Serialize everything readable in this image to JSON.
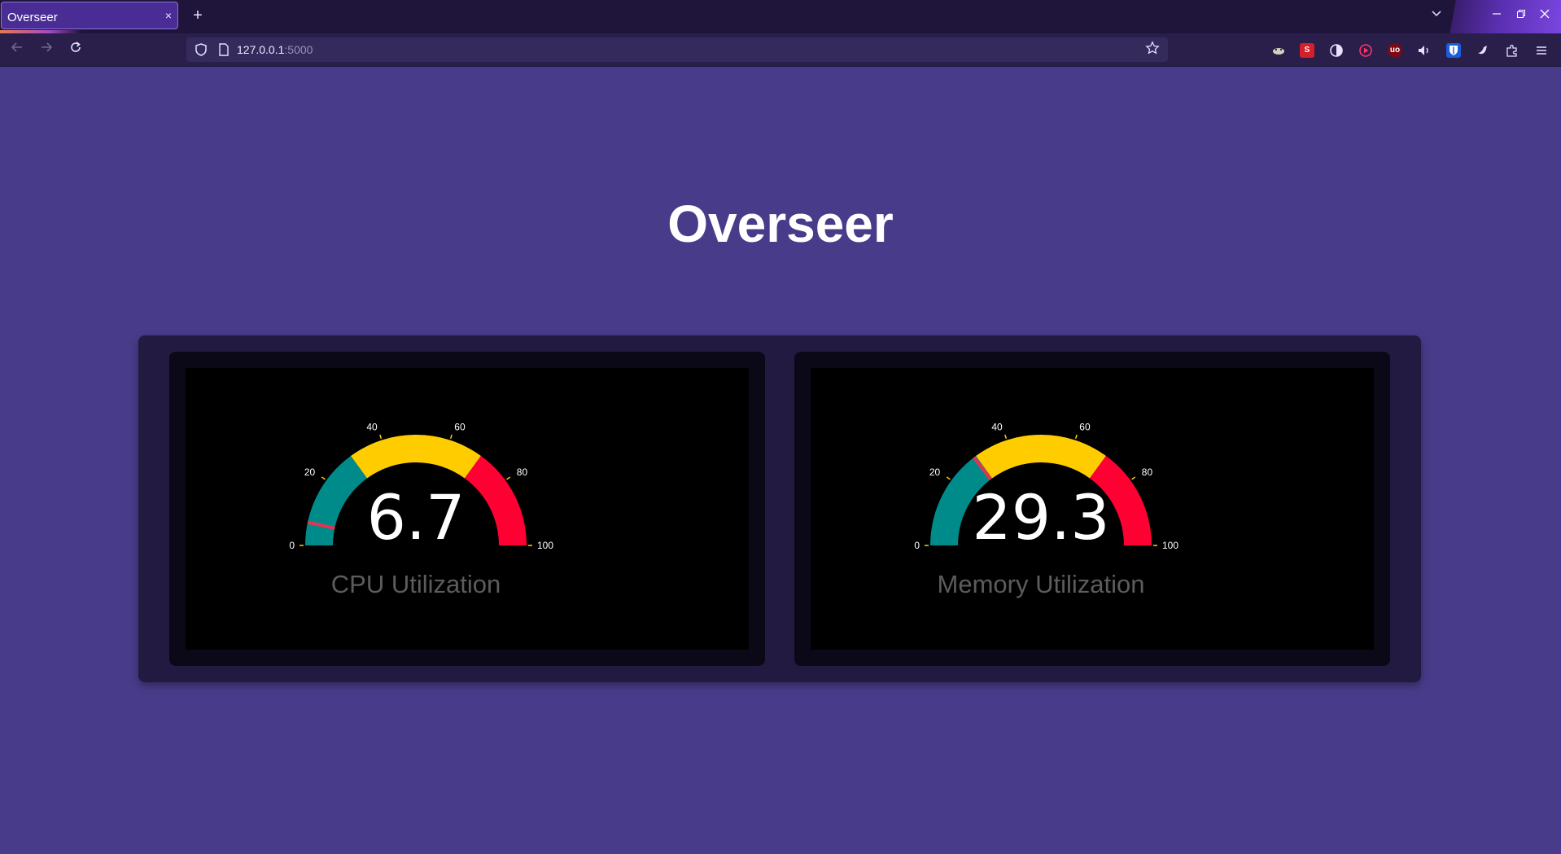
{
  "browser": {
    "tab_title": "Overseer",
    "tab_close": "×",
    "new_tab": "+",
    "url_host": "127.0.0.1",
    "url_port": ":5000"
  },
  "page": {
    "title": "Overseer"
  },
  "gauges": [
    {
      "id": "cpu",
      "label": "CPU Utilization",
      "value_text": "6.7",
      "value": 6.7,
      "min": 0,
      "max": 100,
      "bands": [
        {
          "from": 0,
          "to": 30,
          "color": "#008b8b"
        },
        {
          "from": 30,
          "to": 70,
          "color": "#ffcc00"
        },
        {
          "from": 70,
          "to": 100,
          "color": "#ff0033"
        }
      ],
      "needle_color": "#e53350"
    },
    {
      "id": "memory",
      "label": "Memory Utilization",
      "value_text": "29.3",
      "value": 29.3,
      "min": 0,
      "max": 100,
      "bands": [
        {
          "from": 0,
          "to": 30,
          "color": "#008b8b"
        },
        {
          "from": 30,
          "to": 70,
          "color": "#ffcc00"
        },
        {
          "from": 70,
          "to": 100,
          "color": "#ff0033"
        }
      ],
      "needle_color": "#e53350"
    }
  ],
  "chart_data": [
    {
      "type": "gauge",
      "title": "CPU Utilization",
      "value": 6.7,
      "range": [
        0,
        100
      ],
      "ticks": [
        "0",
        "20",
        "40",
        "60",
        "80",
        "100"
      ]
    },
    {
      "type": "gauge",
      "title": "Memory Utilization",
      "value": 29.3,
      "range": [
        0,
        100
      ],
      "ticks": [
        "0",
        "20",
        "40",
        "60",
        "80",
        "100"
      ]
    }
  ],
  "colors": {
    "page_background": "#483c8a",
    "panel_background": "#221a40",
    "card_background": "#0b0818",
    "label_color": "#5c5c5c",
    "tick_color": "#ffcc00"
  },
  "icons": [
    "back-icon",
    "forward-icon",
    "reload-icon",
    "shield-icon",
    "page-icon",
    "star-icon",
    "extensions-icon",
    "menu-icon"
  ]
}
